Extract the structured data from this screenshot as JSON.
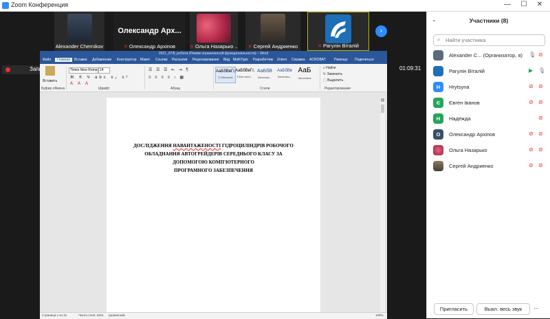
{
  "app": {
    "title": "Zoom Конференция"
  },
  "window_controls": {
    "minimize": "—",
    "maximize": "☐",
    "close": "✕"
  },
  "video_strip": {
    "tiles": [
      {
        "name": "Alexander Chernikov",
        "muted": false
      },
      {
        "name": "Олександр Архіпов",
        "display": "Олександр  Арх...",
        "muted": true
      },
      {
        "name": "Ольга Назарько ...",
        "muted": true
      },
      {
        "name": "Сергей Андриенко",
        "muted": true
      },
      {
        "name": "Рагулін Віталій",
        "muted": true
      }
    ],
    "next_icon": "›"
  },
  "recording": {
    "label": "Запись..."
  },
  "timer": "01:09:31",
  "word": {
    "window_title": "2021_07/8_роботи (Режим ограниченной функциональности) – Word",
    "tabs": [
      "Файл",
      "Главная",
      "Вставка",
      "Добавление",
      "Конструктор",
      "Макет",
      "Ссылки",
      "Рассылки",
      "Рецензирование",
      "Вид",
      "MathType",
      "Разработчик",
      "Zotero",
      "Справка",
      "ACROBAT",
      "Помощн",
      "Поделиться"
    ],
    "active_tab": "Главная",
    "ribbon": {
      "paste": "Вставить",
      "font_name": "Times New Roma",
      "font_size": "14",
      "groups": [
        "Буфер обмена",
        "Шрифт",
        "Абзац",
        "Стили",
        "Редактирование"
      ],
      "styles": [
        {
          "sample": "АаБбВвГг,",
          "name": "¶ Обычный"
        },
        {
          "sample": "АаБбВвГг,",
          "name": "¶ Без инте..."
        },
        {
          "sample": "АаБбВ",
          "name": "Заголово..."
        },
        {
          "sample": "АаБбВв",
          "name": "Заголово..."
        },
        {
          "sample": "АаБ",
          "name": "Заголовок"
        }
      ],
      "editing": [
        "Найти",
        "Заменить",
        "Выделить"
      ]
    },
    "document": {
      "line1_pre": "ДОСЛІДЖЕННЯ ",
      "line1_err": "НАВАНТАЖЕНОСТІ",
      "line1_post": " ГІДРОЦИЛІНДРІВ РОБОЧОГО",
      "line2": "ОБЛАДНАННЯ АВТОГРЕЙДЕРІВ СЕРЕДНЬОГО КЛАСУ ЗА",
      "line3": "ДОПОМОГОЮ КОМП'ЮТЕРНОГО",
      "line4": "ПРОГРАМНОГО ЗАБЕЗПЕЧЕННЯ"
    },
    "status": {
      "page": "Страница 1 из 31",
      "words": "Число слов: 3404",
      "lang": "украинский",
      "zoom": "100%"
    }
  },
  "participants": {
    "header": "Участники (8)",
    "search_placeholder": "Найти участника",
    "list": [
      {
        "name": "Alexander C... (Организатор, я)",
        "initial": "",
        "color": "#5b6b7d",
        "video": "off",
        "mic": "on"
      },
      {
        "name": "Рагулін Віталій",
        "initial": "",
        "color": "#1d6fb8",
        "video": "on",
        "mic": "on"
      },
      {
        "name": "Hrytsyna",
        "initial": "H",
        "color": "#2d8cff",
        "video": "off",
        "mic": "off"
      },
      {
        "name": "Євген Іванов",
        "initial": "Є",
        "color": "#23a55a",
        "video": "off",
        "mic": "off"
      },
      {
        "name": "Надежда",
        "initial": "H",
        "color": "#23a55a",
        "video": "",
        "mic": "off"
      },
      {
        "name": "Олександр Архіпов",
        "initial": "О",
        "color": "#3a4e6b",
        "video": "off",
        "mic": "off"
      },
      {
        "name": "Ольга Назарько",
        "initial": "",
        "color": "#c43a52",
        "video": "off",
        "mic": "off"
      },
      {
        "name": "Сергей Андриенко",
        "initial": "",
        "color": "#7a6a55",
        "video": "off",
        "mic": "off"
      }
    ],
    "invite_label": "Пригласить",
    "mute_all_label": "Выкл. весь звук",
    "more_label": "..."
  }
}
